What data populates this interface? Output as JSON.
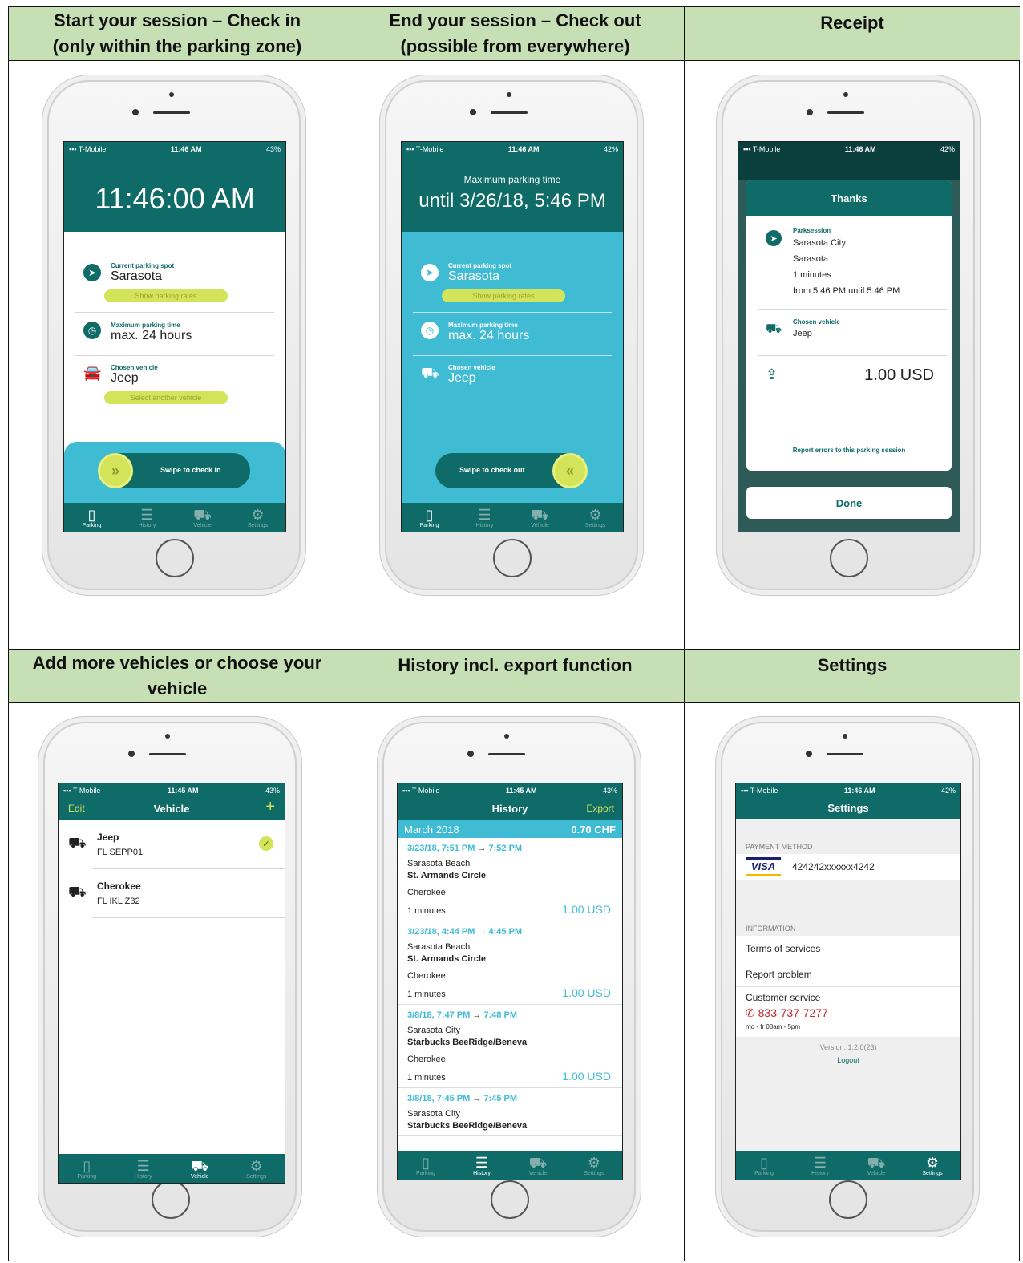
{
  "headers": {
    "c1": "Start your session – Check in\n(only within the parking zone)",
    "c2": "End your session – Check out\n(possible from everywhere)",
    "c3": "Receipt",
    "c4": "Add more vehicles or choose your vehicle",
    "c5": "History incl. export function",
    "c6": "Settings"
  },
  "status": {
    "carrier": "T-Mobile",
    "time_a": "11:46 AM",
    "time_b": "11:45 AM",
    "battery_43": "43%",
    "battery_42": "42%"
  },
  "tabs": {
    "parking": "Parking",
    "history": "History",
    "vehicle": "Vehicle",
    "settings": "Settings"
  },
  "checkin": {
    "clock": "11:46:00 AM",
    "spot_label": "Current parking spot",
    "spot": "Sarasota",
    "rates_btn": "Show parking rates",
    "max_label": "Maximum parking time",
    "max": "max. 24 hours",
    "vehicle_label": "Chosen vehicle",
    "vehicle": "Jeep",
    "select_btn": "Select another vehicle",
    "swipe": "Swipe to check in"
  },
  "checkout": {
    "title": "Maximum parking time",
    "until": "until 3/26/18, 5:46 PM",
    "spot_label": "Current parking spot",
    "spot": "Sarasota",
    "rates_btn": "Show parking rates",
    "max_label": "Maximum parking time",
    "max": "max. 24 hours",
    "vehicle_label": "Chosen vehicle",
    "vehicle": "Jeep",
    "swipe": "Swipe to check out"
  },
  "receipt": {
    "title": "Thanks",
    "session_label": "Parksession",
    "city": "Sarasota City",
    "area": "Sarasota",
    "duration": "1 minutes",
    "range": "from 5:46 PM until 5:46 PM",
    "vehicle_label": "Chosen vehicle",
    "vehicle": "Jeep",
    "amount": "1.00 USD",
    "report": "Report errors to this parking session",
    "done": "Done"
  },
  "vehicles": {
    "edit": "Edit",
    "title": "Vehicle",
    "add": "+",
    "items": [
      {
        "name": "Jeep",
        "plate": "FL SEPP01"
      },
      {
        "name": "Cherokee",
        "plate": "FL IKL Z32"
      }
    ]
  },
  "history": {
    "title": "History",
    "export": "Export",
    "month": "March 2018",
    "month_total": "0.70 CHF",
    "entries": [
      {
        "start": "3/23/18, 7:51 PM",
        "end": "7:52 PM",
        "city": "Sarasota Beach",
        "zone": "St. Armands Circle",
        "vehicle": "Cherokee",
        "duration": "1 minutes",
        "amount": "1.00 USD"
      },
      {
        "start": "3/23/18, 4:44 PM",
        "end": "4:45 PM",
        "city": "Sarasota Beach",
        "zone": "St. Armands Circle",
        "vehicle": "Cherokee",
        "duration": "1 minutes",
        "amount": "1.00 USD"
      },
      {
        "start": "3/8/18, 7:47 PM",
        "end": "7:48 PM",
        "city": "Sarasota City",
        "zone": "Starbucks BeeRidge/Beneva",
        "vehicle": "Cherokee",
        "duration": "1 minutes",
        "amount": "1.00 USD"
      },
      {
        "start": "3/8/18, 7:45 PM",
        "end": "7:45 PM",
        "city": "Sarasota City",
        "zone": "Starbucks BeeRidge/Beneva"
      }
    ]
  },
  "settings": {
    "title": "Settings",
    "payment_hdr": "PAYMENT METHOD",
    "card_brand": "VISA",
    "card_number": "424242xxxxxx4242",
    "info_hdr": "INFORMATION",
    "terms": "Terms of services",
    "report": "Report problem",
    "customer": "Customer service",
    "phone": "833-737-7277",
    "hours": "mo - fr 08am - 5pm",
    "version": "Version: 1.2.0(23)",
    "logout": "Logout"
  },
  "colors": {
    "teal": "#0e6b68",
    "cyan": "#40bbd4",
    "lime": "#d3e35a",
    "header_green": "#c6dfb5",
    "phone_red": "#c0272d"
  },
  "icons": [
    "signal-icon",
    "wifi-icon",
    "location-arrow-icon",
    "clock-icon",
    "car-icon",
    "chevrons-right-icon",
    "chevrons-left-icon",
    "share-icon",
    "check-icon",
    "phone-icon",
    "parking-meter-icon",
    "list-icon",
    "gear-icon"
  ]
}
